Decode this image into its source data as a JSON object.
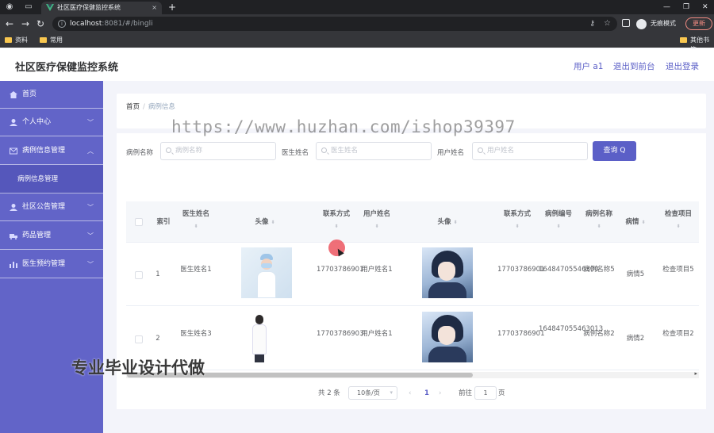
{
  "browser": {
    "tab_title": "社区医疗保健监控系统",
    "tab_close": "×",
    "new_tab": "+",
    "url_host": "localhost",
    "url_path": ":8081/#/bingli",
    "profile_label": "无痕模式",
    "update_label": "更新",
    "bookmarks": [
      "资料",
      "常用"
    ],
    "bookmark_other": "其他书签"
  },
  "app": {
    "title": "社区医疗保健监控系统",
    "header_links": [
      "用户 a1",
      "退出到前台",
      "退出登录"
    ]
  },
  "sidebar": {
    "items": [
      {
        "label": "首页",
        "arrow": ""
      },
      {
        "label": "个人中心",
        "arrow": "﹀"
      },
      {
        "label": "病例信息管理",
        "arrow": "︿"
      },
      {
        "label": "社区公告管理",
        "arrow": "﹀"
      },
      {
        "label": "药品管理",
        "arrow": "﹀"
      },
      {
        "label": "医生预约管理",
        "arrow": "﹀"
      }
    ],
    "submenu_active": "病例信息管理"
  },
  "breadcrumb": {
    "home": "首页",
    "separator": "/",
    "current": "病例信息"
  },
  "filters": [
    {
      "label": "病例名称",
      "placeholder": "病例名称"
    },
    {
      "label": "医生姓名",
      "placeholder": "医生姓名"
    },
    {
      "label": "用户姓名",
      "placeholder": "用户姓名"
    }
  ],
  "search_button": "查询 Q",
  "table": {
    "headers": {
      "index": "索引",
      "doctor_name": "医生姓名",
      "avatar1": "头像",
      "contact1": "联系方式",
      "user_name": "用户姓名",
      "avatar2": "头像",
      "contact2": "联系方式",
      "case_no": "病例编号",
      "case_name": "病例名称",
      "condition": "病情",
      "exam": "检查项目"
    },
    "sort_glyph": "⬍",
    "rows": [
      {
        "index": "1",
        "doctor_name": "医生姓名1",
        "contact1": "17703786901",
        "user_name": "用户姓名1",
        "contact2": "17703786901",
        "case_no": "16484705546300",
        "case_name": "病例名称5",
        "condition": "病情5",
        "exam": "检查项目5"
      },
      {
        "index": "2",
        "doctor_name": "医生姓名3",
        "contact1": "17703786903",
        "user_name": "用户姓名1",
        "contact2": "17703786901",
        "case_no": "164847055463013",
        "case_name": "病例名称2",
        "condition": "病情2",
        "exam": "检查项目2"
      }
    ]
  },
  "pagination": {
    "total": "共 2 条",
    "page_size": "10条/页",
    "prev": "‹",
    "current": "1",
    "next": "›",
    "goto_prefix": "前往",
    "goto_value": "1",
    "goto_suffix": "页"
  },
  "overlays": {
    "watermark": "https://www.huzhan.com/ishop39397",
    "promo": "专业毕业设计代做"
  },
  "colors": {
    "accent": "#5b5fc7",
    "sidebar": "#6264c8"
  }
}
